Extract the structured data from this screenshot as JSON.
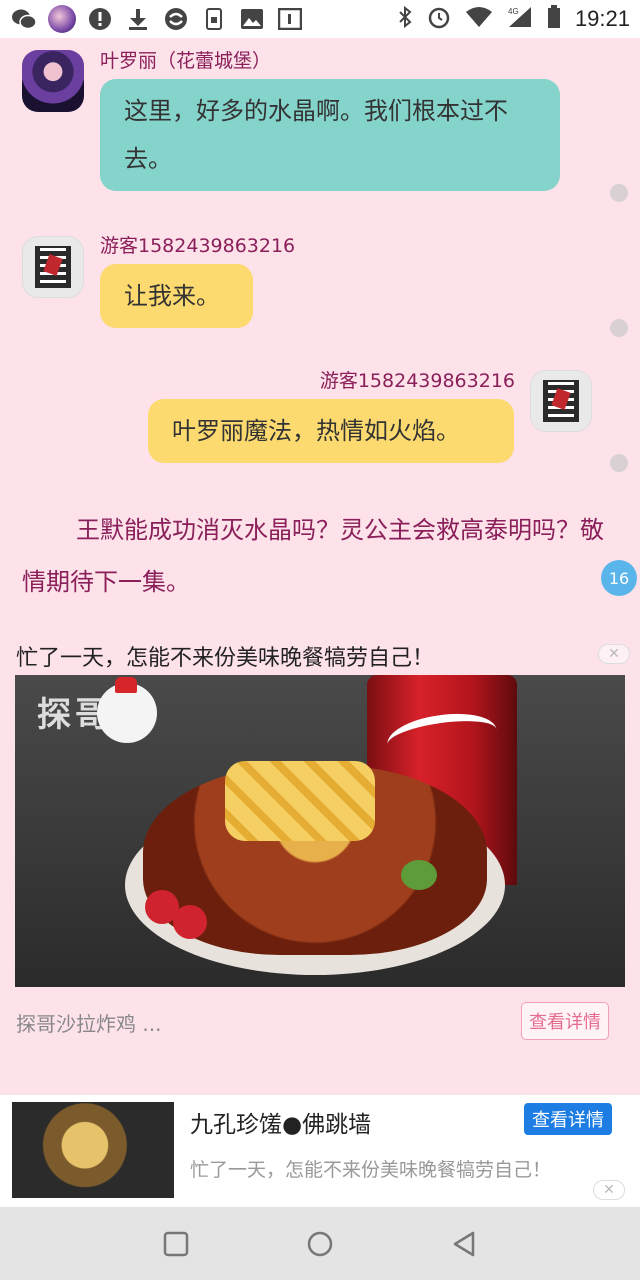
{
  "status_bar": {
    "time": "19:21",
    "network": "4G"
  },
  "chat": {
    "messages": [
      {
        "sender": "叶罗丽（花蕾城堡）",
        "text": "这里，好多的水晶啊。我们根本过不去。",
        "side": "left",
        "color": "#84d4cb"
      },
      {
        "sender": "游客1582439863216",
        "text": "让我来。",
        "side": "left",
        "color": "#fcda6f"
      },
      {
        "sender": "游客1582439863216",
        "text": "叶罗丽魔法，热情如火焰。",
        "side": "right",
        "color": "#fcda6f"
      }
    ],
    "narration": "王默能成功消灭水晶吗？灵公主会救高泰明吗？敬情期待下一集。",
    "page_badge": "16"
  },
  "ad": {
    "title": "忙了一天，怎能不来份美味晚餐犒劳自己！",
    "image_brand": "探哥",
    "subtitle": "探哥沙拉炸鸡 ...",
    "detail_button": "查看详情",
    "close": "✕"
  },
  "banner": {
    "title": "九孔珍馐●佛跳墙",
    "desc": "忙了一天，怎能不来份美味晚餐犒劳自己！",
    "button": "查看详情",
    "close": "✕"
  },
  "colors": {
    "page_bg": "#fde2ea",
    "name_color": "#8a1f5a",
    "teal_bubble": "#84d4cb",
    "yellow_bubble": "#fcda6f",
    "badge_blue": "#5ab5ea",
    "banner_button": "#1e7de3"
  }
}
